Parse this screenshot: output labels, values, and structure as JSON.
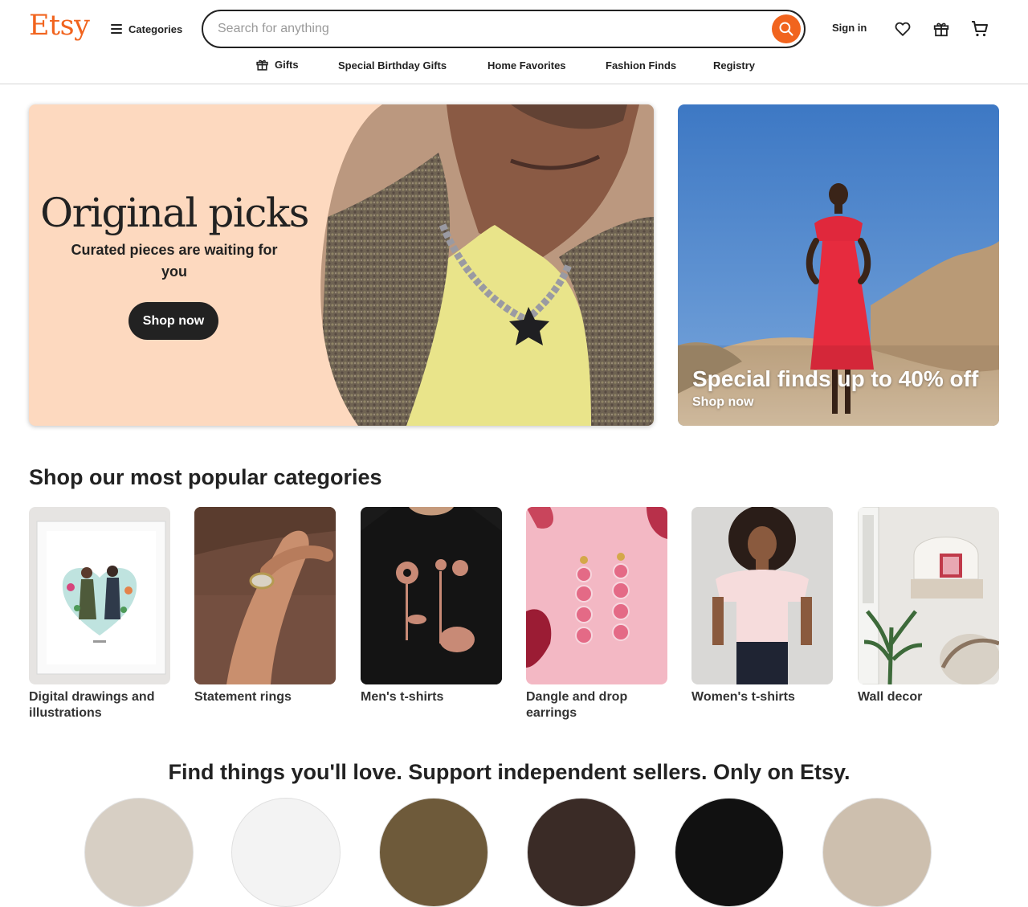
{
  "header": {
    "logo": "Etsy",
    "categories_label": "Categories",
    "search_placeholder": "Search for anything",
    "sign_in": "Sign in"
  },
  "subnav": {
    "items": [
      {
        "label": "Gifts",
        "icon": "gift-icon"
      },
      {
        "label": "Special Birthday Gifts"
      },
      {
        "label": "Home Favorites"
      },
      {
        "label": "Fashion Finds"
      },
      {
        "label": "Registry"
      }
    ]
  },
  "hero": {
    "title": "Original picks",
    "subtitle": "Curated pieces are waiting for you",
    "button": "Shop now"
  },
  "promo": {
    "title": "Special finds up to 40% off",
    "link": "Shop now"
  },
  "categories": {
    "title": "Shop our most popular categories",
    "items": [
      {
        "label": "Digital drawings and illustrations"
      },
      {
        "label": "Statement rings"
      },
      {
        "label": "Men's t-shirts"
      },
      {
        "label": "Dangle and drop earrings"
      },
      {
        "label": "Women's t-shirts"
      },
      {
        "label": "Wall decor"
      }
    ]
  },
  "tagline": "Find things you'll love. Support independent sellers. Only on Etsy.",
  "colors": {
    "brand": "#f1641e",
    "hero_bg": "#fdd9bf",
    "button_dark": "#222222"
  }
}
